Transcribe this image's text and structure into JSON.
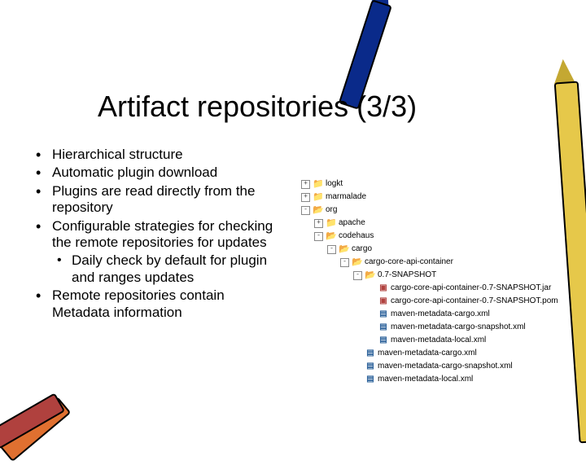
{
  "title": "Artifact repositories (3/3)",
  "bullets": [
    {
      "text": "Hierarchical structure"
    },
    {
      "text": "Automatic plugin download"
    },
    {
      "text": "Plugins are read directly from the repository"
    },
    {
      "text": "Configurable strategies for checking the remote repositories for updates",
      "sub": [
        {
          "text": "Daily check by default for plugin and ranges updates"
        }
      ]
    },
    {
      "text": "Remote repositories contain Metadata information"
    }
  ],
  "tree": [
    {
      "depth": 0,
      "toggle": "+",
      "icon": "folder",
      "label": "logkt"
    },
    {
      "depth": 0,
      "toggle": "+",
      "icon": "folder",
      "label": "marmalade"
    },
    {
      "depth": 0,
      "toggle": "-",
      "icon": "folder-open",
      "label": "org"
    },
    {
      "depth": 1,
      "toggle": "+",
      "icon": "folder",
      "label": "apache"
    },
    {
      "depth": 1,
      "toggle": "-",
      "icon": "folder-open",
      "label": "codehaus"
    },
    {
      "depth": 2,
      "toggle": "-",
      "icon": "folder-open",
      "label": "cargo"
    },
    {
      "depth": 3,
      "toggle": "-",
      "icon": "folder-open",
      "label": "cargo-core-api-container"
    },
    {
      "depth": 4,
      "toggle": "-",
      "icon": "folder-open",
      "label": "0.7-SNAPSHOT"
    },
    {
      "depth": 5,
      "toggle": "",
      "icon": "jar",
      "label": "cargo-core-api-container-0.7-SNAPSHOT.jar"
    },
    {
      "depth": 5,
      "toggle": "",
      "icon": "jar",
      "label": "cargo-core-api-container-0.7-SNAPSHOT.pom"
    },
    {
      "depth": 5,
      "toggle": "",
      "icon": "xml",
      "label": "maven-metadata-cargo.xml"
    },
    {
      "depth": 5,
      "toggle": "",
      "icon": "xml",
      "label": "maven-metadata-cargo-snapshot.xml"
    },
    {
      "depth": 5,
      "toggle": "",
      "icon": "xml",
      "label": "maven-metadata-local.xml"
    },
    {
      "depth": 4,
      "toggle": "",
      "icon": "xml",
      "label": "maven-metadata-cargo.xml"
    },
    {
      "depth": 4,
      "toggle": "",
      "icon": "xml",
      "label": "maven-metadata-cargo-snapshot.xml"
    },
    {
      "depth": 4,
      "toggle": "",
      "icon": "xml",
      "label": "maven-metadata-local.xml"
    }
  ]
}
